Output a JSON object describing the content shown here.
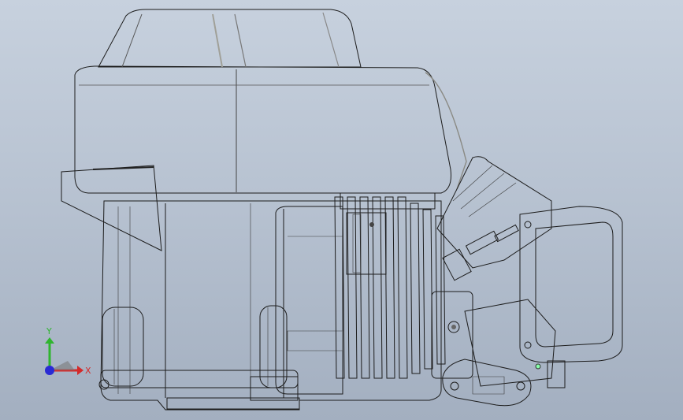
{
  "viewport": {
    "background_top": "#c7d1de",
    "background_bottom": "#a3afc0"
  },
  "triad": {
    "x_label": "X",
    "y_label": "Y",
    "x_color": "#d42a2a",
    "y_color": "#2fb52f",
    "z_color": "#2a2ad4"
  },
  "model": {
    "shroud_color": "#1f1f1f",
    "body_color": "#f4f4ea"
  }
}
